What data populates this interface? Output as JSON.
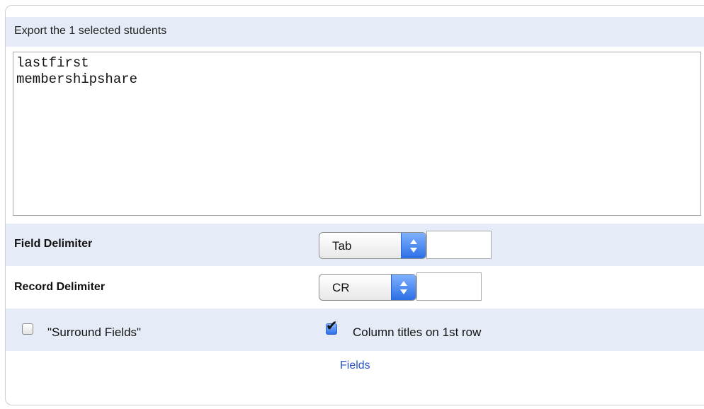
{
  "export": {
    "header": "Export the 1 selected students",
    "fields_text": "lastfirst\nmembershipshare"
  },
  "field_delimiter": {
    "label": "Field Delimiter",
    "selected": "Tab",
    "custom_value": ""
  },
  "record_delimiter": {
    "label": "Record Delimiter",
    "selected": "CR",
    "custom_value": ""
  },
  "options": {
    "surround_fields": {
      "label": "\"Surround Fields\"",
      "checked": false
    },
    "column_titles": {
      "label": "Column titles on 1st row",
      "checked": true
    }
  },
  "fields_link": "Fields",
  "icons": {
    "select_arrow": "up-down-arrows-icon",
    "checkmark": "checkmark-icon"
  },
  "colors": {
    "row_background": "#e6ecf7",
    "select_accent": "#2c6fe6",
    "link": "#2a56c6"
  }
}
